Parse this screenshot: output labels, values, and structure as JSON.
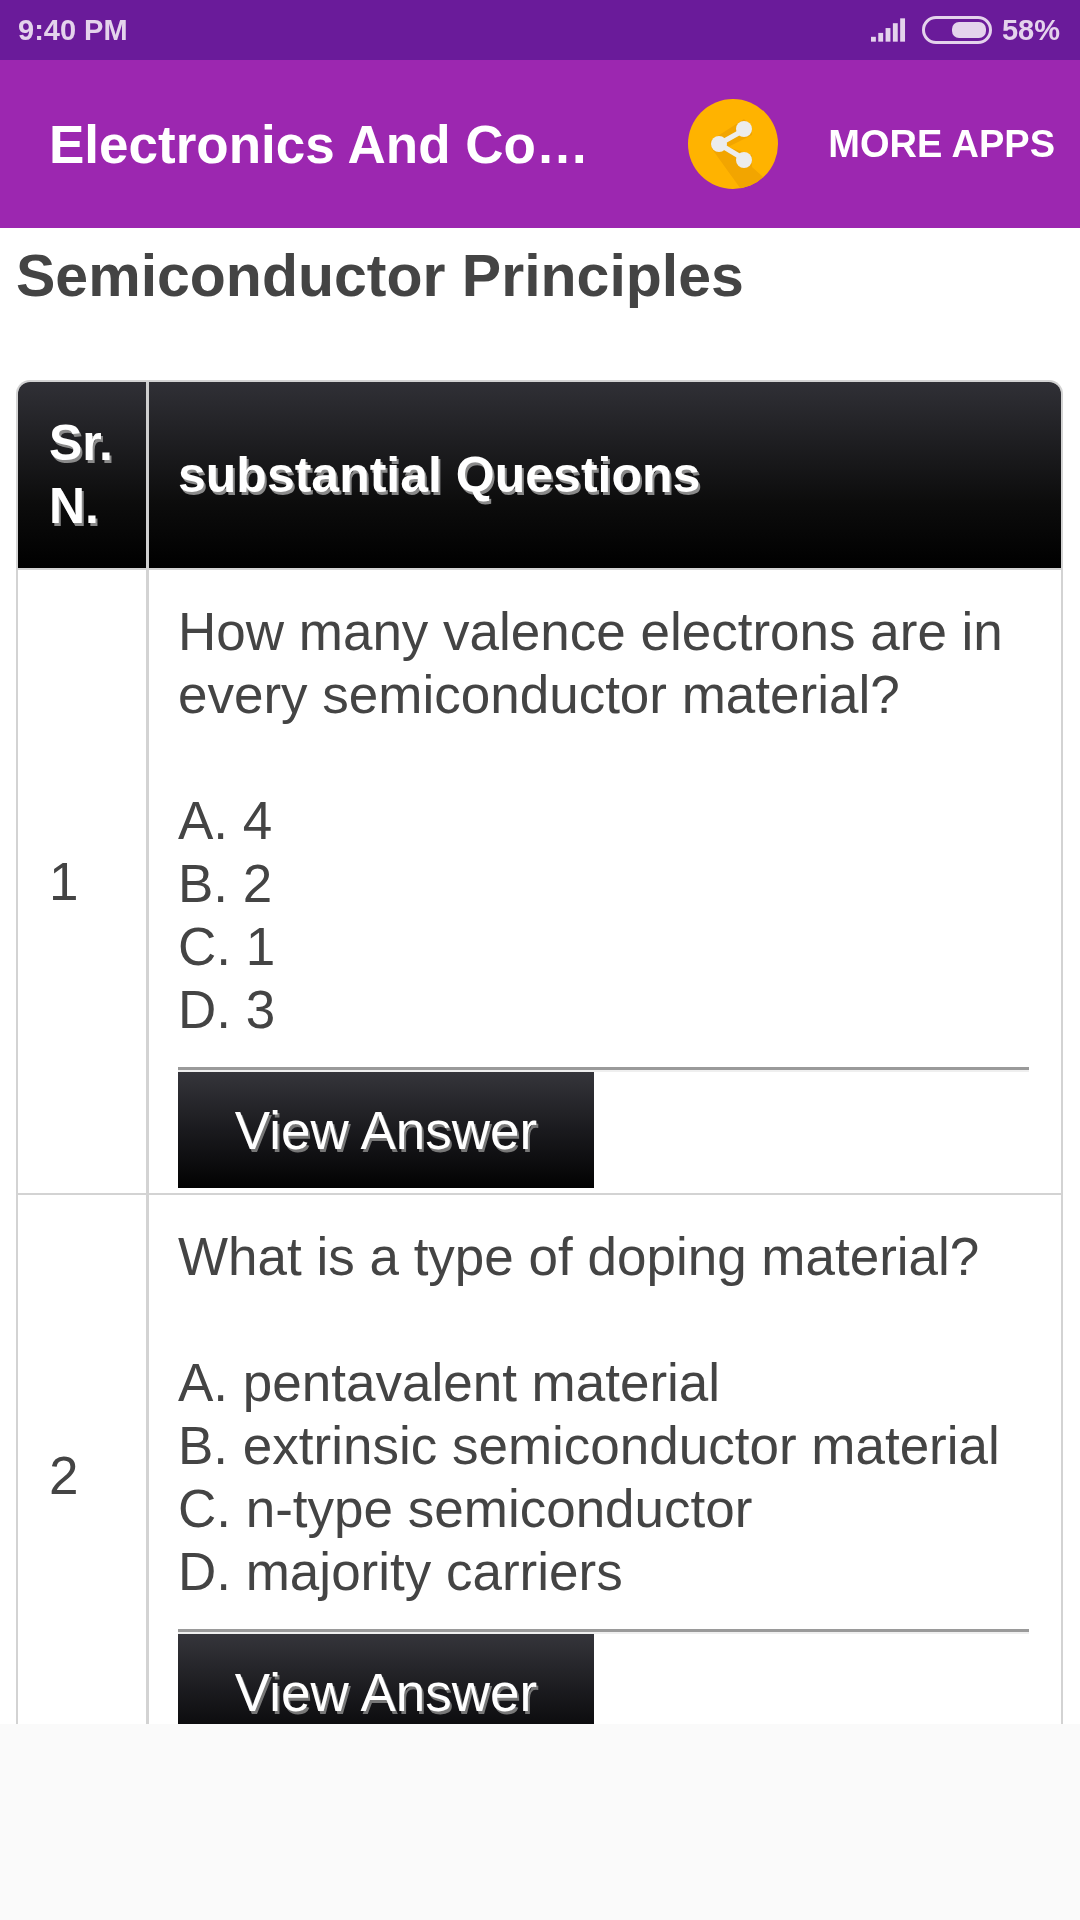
{
  "status_bar": {
    "time": "9:40 PM",
    "battery": "58%"
  },
  "app_bar": {
    "title": "Electronics And Co…",
    "more_apps": "MORE APPS"
  },
  "page_title": "Semiconductor Principles",
  "table": {
    "columns": [
      "Sr. N.",
      "substantial Questions"
    ],
    "rows": [
      {
        "number": "1",
        "question": "How many valence electrons are in every semiconductor material?",
        "options": [
          "A. 4",
          "B. 2",
          "C. 1",
          "D. 3"
        ],
        "button": "View Answer"
      },
      {
        "number": "2",
        "question": "What is a type of doping material?",
        "options": [
          "A. pentavalent material",
          "B. extrinsic semiconductor material",
          "C. n-type semiconductor",
          "D. majority carriers"
        ],
        "button": "View Answer"
      }
    ]
  }
}
